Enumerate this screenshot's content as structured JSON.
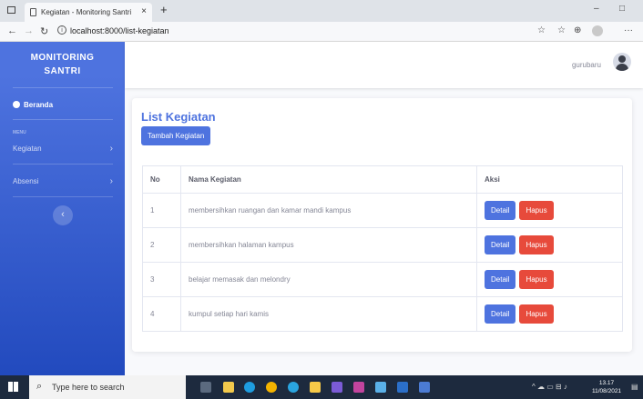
{
  "browser": {
    "tab_title": "Kegiatan - Monitoring Santri",
    "url": "localhost:8000/list-kegiatan"
  },
  "sidebar": {
    "brand_line1": "MONITORING",
    "brand_line2": "SANTRI",
    "home_label": "Beranda",
    "menu_heading": "MENU",
    "items": [
      {
        "label": "Kegiatan"
      },
      {
        "label": "Absensi"
      }
    ]
  },
  "topbar": {
    "user_name": "gurubaru"
  },
  "page": {
    "title": "List Kegiatan",
    "add_button": "Tambah Kegiatan"
  },
  "table": {
    "headers": [
      "No",
      "Nama Kegiatan",
      "Aksi"
    ],
    "rows": [
      {
        "no": "1",
        "name": "membersihkan ruangan dan kamar mandi kampus"
      },
      {
        "no": "2",
        "name": "membersihkan halaman kampus"
      },
      {
        "no": "3",
        "name": "belajar memasak dan melondry"
      },
      {
        "no": "4",
        "name": "kumpul setiap hari kamis"
      }
    ],
    "detail_label": "Detail",
    "delete_label": "Hapus"
  },
  "taskbar": {
    "search_placeholder": "Type here to search",
    "time": "13.17",
    "date": "11/08/2021"
  },
  "colors": {
    "primary": "#4e73df",
    "danger": "#e74a3b",
    "sidebar_gradient_end": "#224abe"
  }
}
